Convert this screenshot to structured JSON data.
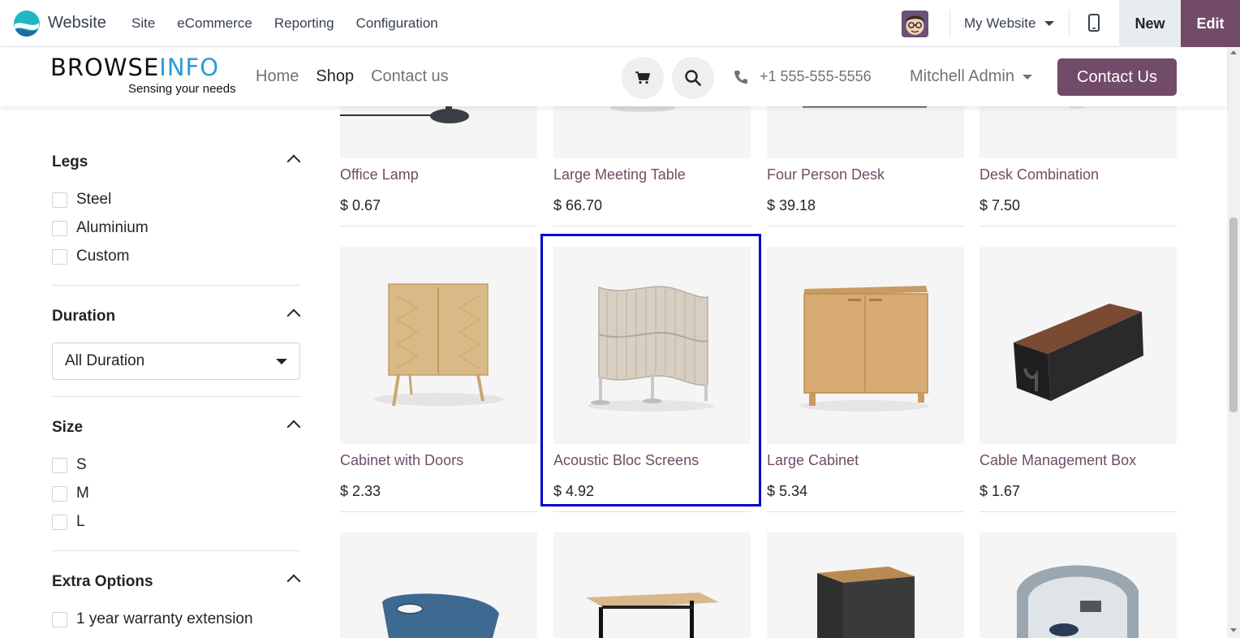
{
  "admin_bar": {
    "app_name": "Website",
    "menu": [
      "Site",
      "eCommerce",
      "Reporting",
      "Configuration"
    ],
    "website_selector": "My Website",
    "new_label": "New",
    "edit_label": "Edit"
  },
  "site_header": {
    "brand_prefix": "BROWSE",
    "brand_suffix": "INFO",
    "brand_tagline": "Sensing your needs",
    "nav": [
      "Home",
      "Shop",
      "Contact us"
    ],
    "active_nav": "Shop",
    "phone": "+1 555-555-5556",
    "user": "Mitchell Admin",
    "contact_button": "Contact Us"
  },
  "filters": {
    "legs": {
      "title": "Legs",
      "options": [
        "Steel",
        "Aluminium",
        "Custom"
      ]
    },
    "duration": {
      "title": "Duration",
      "selected": "All Duration"
    },
    "size": {
      "title": "Size",
      "options": [
        "S",
        "M",
        "L"
      ]
    },
    "extra": {
      "title": "Extra Options",
      "options": [
        "1 year warranty extension"
      ]
    }
  },
  "products_row1": [
    {
      "name": "Office Lamp",
      "price": "$ 0.67"
    },
    {
      "name": "Large Meeting Table",
      "price": "$ 66.70"
    },
    {
      "name": "Four Person Desk",
      "price": "$ 39.18"
    },
    {
      "name": "Desk Combination",
      "price": "$ 7.50"
    }
  ],
  "products_row2": [
    {
      "name": "Cabinet with Doors",
      "price": "$ 2.33"
    },
    {
      "name": "Acoustic Bloc Screens",
      "price": "$ 4.92"
    },
    {
      "name": "Large Cabinet",
      "price": "$ 5.34"
    },
    {
      "name": "Cable Management Box",
      "price": "$ 1.67"
    }
  ],
  "colors": {
    "brand_primary": "#714b67",
    "brand_info_blue": "#2b9bd6",
    "highlight": "#0000cc"
  }
}
